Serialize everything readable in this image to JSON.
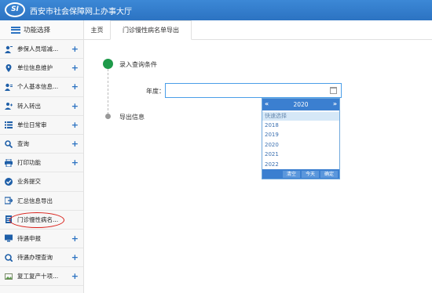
{
  "header": {
    "logo_text": "SI",
    "title": "西安市社会保障网上办事大厅"
  },
  "sidebar": {
    "head_label": "功能选择",
    "items": [
      {
        "label": "参保人员增减...",
        "icon": "user-add-icon",
        "plus": true
      },
      {
        "label": "单位信息维护",
        "icon": "location-icon",
        "plus": true
      },
      {
        "label": "个人基本信息...",
        "icon": "id-card-icon",
        "plus": true
      },
      {
        "label": "转入转出",
        "icon": "transfer-icon",
        "plus": true
      },
      {
        "label": "单位日常审",
        "icon": "list-icon",
        "plus": true
      },
      {
        "label": "查询",
        "icon": "search-icon",
        "plus": true
      },
      {
        "label": "打印功能",
        "icon": "print-icon",
        "plus": true
      },
      {
        "label": "业务提交",
        "icon": "check-circle-icon",
        "plus": false
      },
      {
        "label": "汇总信息导出",
        "icon": "export-icon",
        "plus": false
      },
      {
        "label": "门诊慢性病名...",
        "icon": "document-icon",
        "plus": false
      },
      {
        "label": "待遇申报",
        "icon": "monitor-icon",
        "plus": true
      },
      {
        "label": "待遇办理查询",
        "icon": "search-doc-icon",
        "plus": true
      },
      {
        "label": "复工复产十项...",
        "icon": "image-icon",
        "plus": true
      }
    ],
    "plus_glyph": "+"
  },
  "tabs": {
    "home": "主页",
    "active": "门诊慢性病名单导出"
  },
  "steps": {
    "step1": "录入查询条件",
    "step2": "导出信息"
  },
  "form": {
    "year_label": "年度：",
    "year_value": ""
  },
  "picker": {
    "prev": "«",
    "next": "»",
    "current_year": "2020",
    "quick_label": "快速选择",
    "years": [
      "2018",
      "2019",
      "2020",
      "2021",
      "2022"
    ],
    "buttons": {
      "clear": "清空",
      "today": "今天",
      "confirm": "确定"
    }
  },
  "colors": {
    "header_blue": "#2c73c2",
    "step_green": "#1e9a4a",
    "highlight_red": "#d91e18"
  }
}
